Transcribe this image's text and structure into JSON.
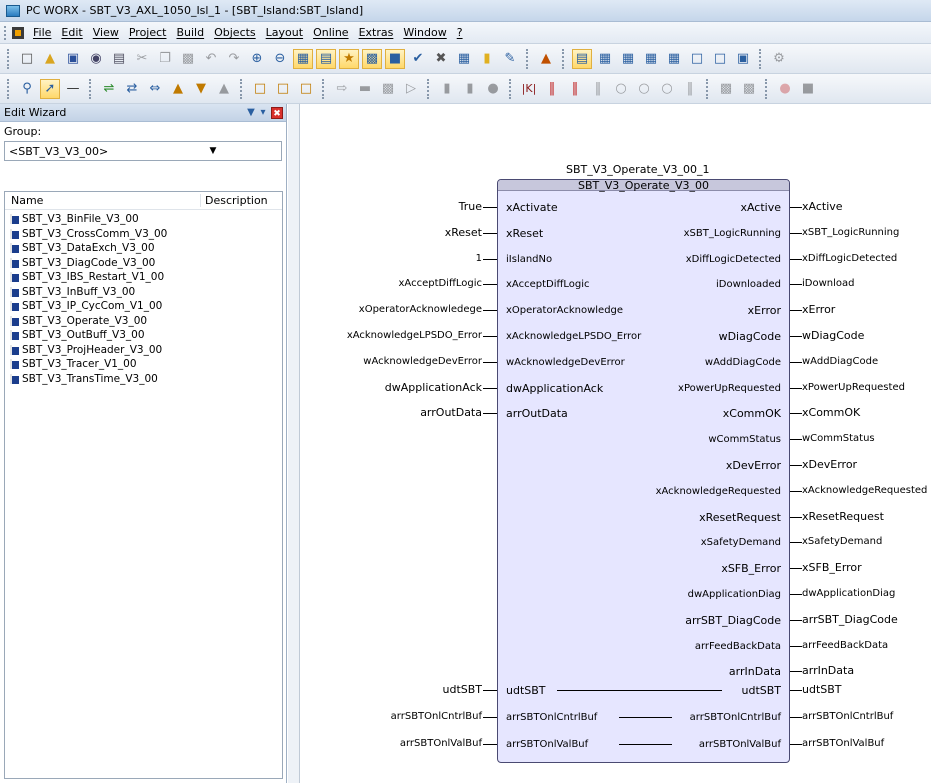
{
  "window": {
    "title": "PC WORX - SBT_V3_AXL_1050_Isl_1 - [SBT_Island:SBT_Island]"
  },
  "menu": [
    "File",
    "Edit",
    "View",
    "Project",
    "Build",
    "Objects",
    "Layout",
    "Online",
    "Extras",
    "Window",
    "?"
  ],
  "edit_wizard": {
    "title": "Edit Wizard",
    "group_label": "Group:",
    "group_value": "<SBT_V3_V3_00>",
    "col_name": "Name",
    "col_desc": "Description",
    "items": [
      "SBT_V3_BinFile_V3_00",
      "SBT_V3_CrossComm_V3_00",
      "SBT_V3_DataExch_V3_00",
      "SBT_V3_DiagCode_V3_00",
      "SBT_V3_IBS_Restart_V1_00",
      "SBT_V3_InBuff_V3_00",
      "SBT_V3_IP_CycCom_V1_00",
      "SBT_V3_Operate_V3_00",
      "SBT_V3_OutBuff_V3_00",
      "SBT_V3_ProjHeader_V3_00",
      "SBT_V3_Tracer_V1_00",
      "SBT_V3_TransTime_V3_00"
    ]
  },
  "block": {
    "instance_name": "SBT_V3_Operate_V3_00_1",
    "type_name": "SBT_V3_Operate_V3_00",
    "inputs": [
      {
        "pin": "xActivate",
        "var": "True"
      },
      {
        "pin": "xReset",
        "var": "xReset"
      },
      {
        "pin": "iIslandNo",
        "var": "1"
      },
      {
        "pin": "xAcceptDiffLogic",
        "var": "xAcceptDiffLogic"
      },
      {
        "pin": "xOperatorAcknowledge",
        "var": "xOperatorAcknowledege"
      },
      {
        "pin": "xAcknowledgeLPSDO_Error",
        "var": "xAcknowledgeLPSDO_Error"
      },
      {
        "pin": "wAcknowledgeDevError",
        "var": "wAcknowledgeDevError"
      },
      {
        "pin": "dwApplicationAck",
        "var": "dwApplicationAck"
      },
      {
        "pin": "arrOutData",
        "var": "arrOutData"
      }
    ],
    "outputs": [
      {
        "pin": "xActive",
        "var": "xActive"
      },
      {
        "pin": "xSBT_LogicRunning",
        "var": "xSBT_LogicRunning"
      },
      {
        "pin": "xDiffLogicDetected",
        "var": "xDiffLogicDetected"
      },
      {
        "pin": "iDownloaded",
        "var": "iDownload"
      },
      {
        "pin": "xError",
        "var": "xError"
      },
      {
        "pin": "wDiagCode",
        "var": "wDiagCode"
      },
      {
        "pin": "wAddDiagCode",
        "var": "wAddDiagCode"
      },
      {
        "pin": "xPowerUpRequested",
        "var": "xPowerUpRequested"
      },
      {
        "pin": "xCommOK",
        "var": "xCommOK"
      },
      {
        "pin": "wCommStatus",
        "var": "wCommStatus"
      },
      {
        "pin": "xDevError",
        "var": "xDevError"
      },
      {
        "pin": "xAcknowledgeRequested",
        "var": "xAcknowledgeRequested"
      },
      {
        "pin": "xResetRequest",
        "var": "xResetRequest"
      },
      {
        "pin": "xSafetyDemand",
        "var": "xSafetyDemand"
      },
      {
        "pin": "xSFB_Error",
        "var": "xSFB_Error"
      },
      {
        "pin": "dwApplicationDiag",
        "var": "dwApplicationDiag"
      },
      {
        "pin": "arrSBT_DiagCode",
        "var": "arrSBT_DiagCode"
      },
      {
        "pin": "arrFeedBackData",
        "var": "arrFeedBackData"
      },
      {
        "pin": "arrInData",
        "var": "arrInData"
      }
    ],
    "inouts": [
      {
        "pin": "udtSBT",
        "var": "udtSBT"
      },
      {
        "pin": "arrSBTOnlCntrlBuf",
        "var": "arrSBTOnlCntrlBuf"
      },
      {
        "pin": "arrSBTOnlValBuf",
        "var": "arrSBTOnlValBuf"
      }
    ]
  }
}
